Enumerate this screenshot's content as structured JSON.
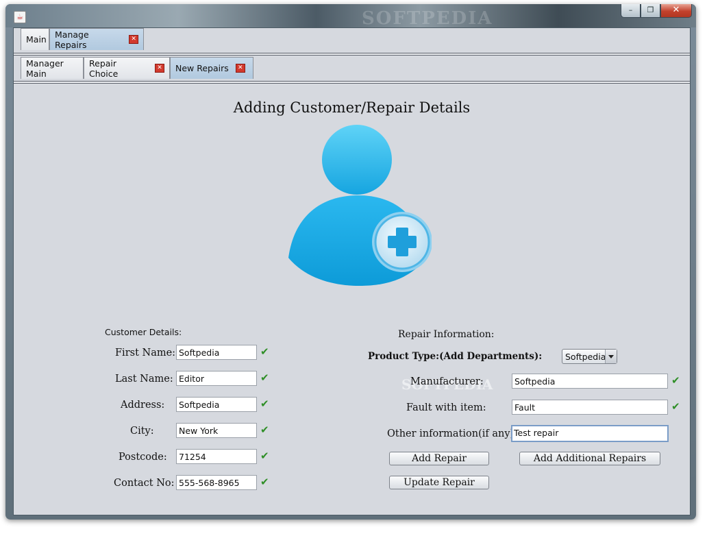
{
  "window": {
    "watermark": "SOFTPEDIA",
    "controls": {
      "minimize": "–",
      "maximize": "❐",
      "close": "✕"
    }
  },
  "tabs_main": [
    {
      "label": "Main",
      "closable": false,
      "active": false
    },
    {
      "label": "Manage Repairs",
      "closable": true,
      "active": true
    }
  ],
  "tabs_sub": [
    {
      "label": "Manager Main",
      "closable": false,
      "active": false
    },
    {
      "label": "Repair Choice",
      "closable": true,
      "active": false
    },
    {
      "label": "New Repairs",
      "closable": true,
      "active": true
    }
  ],
  "tab_close_glyph": "✕",
  "page": {
    "title": "Adding Customer/Repair Details",
    "avatar_icon": "add-user-icon"
  },
  "customer": {
    "section_label": "Customer Details:",
    "fields": [
      {
        "label": "First Name:",
        "value": "Softpedia"
      },
      {
        "label": "Last Name:",
        "value": "Editor"
      },
      {
        "label": "Address:",
        "value": "Softpedia"
      },
      {
        "label": "City:",
        "value": "New York"
      },
      {
        "label": "Postcode:",
        "value": "71254"
      },
      {
        "label": "Contact No:",
        "value": "555-568-8965"
      }
    ]
  },
  "repair": {
    "section_label": "Repair Information:",
    "product_type_label": "Product Type:(Add Departments):",
    "product_type_value": "Softpedia",
    "fields": [
      {
        "label": "Manufacturer:",
        "value": "Softpedia"
      },
      {
        "label": "Fault with item:",
        "value": "Fault"
      },
      {
        "label": "Other information(if any):",
        "value": "Test repair"
      }
    ]
  },
  "buttons": {
    "add_repair": "Add Repair",
    "add_additional": "Add Additional Repairs",
    "update_repair": "Update Repair"
  },
  "check_glyph": "✔",
  "colors": {
    "check": "#2f8f27",
    "active_tab": "#b9cfe3",
    "panel": "#d6d9df",
    "avatar": "#1aa6e0"
  }
}
